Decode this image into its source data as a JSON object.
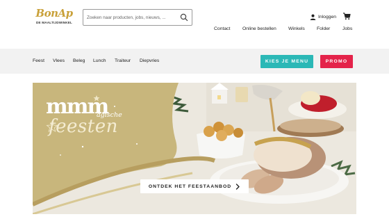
{
  "header": {
    "logo_text": "BonAp",
    "logo_subtext": "DE MAALTIJDWINKEL",
    "search_placeholder": "Zoeken naar producten, jobs, nieuws, ...",
    "login_label": "Inloggen",
    "top_nav": [
      "Contact",
      "Online bestellen",
      "Winkels",
      "Folder",
      "Jobs"
    ]
  },
  "category_bar": {
    "items": [
      "Feest",
      "Vlees",
      "Beleg",
      "Lunch",
      "Traiteur",
      "Diepvries"
    ],
    "menu_button": "KIES JE MENU",
    "promo_button": "PROMO"
  },
  "banner": {
    "headline_mmm": "mmm",
    "headline_magische": "agische",
    "headline_feesten": "feesten",
    "cta_label": "ONTDEK HET FEESTAANBOD"
  },
  "colors": {
    "brand_gold": "#c9a13a",
    "menu_button": "#2bb8b6",
    "promo_button": "#e4234a",
    "banner_gold": "#c8b67c"
  },
  "icons": [
    "search-icon",
    "user-icon",
    "cart-icon",
    "chevron-right-icon",
    "star-icon"
  ]
}
